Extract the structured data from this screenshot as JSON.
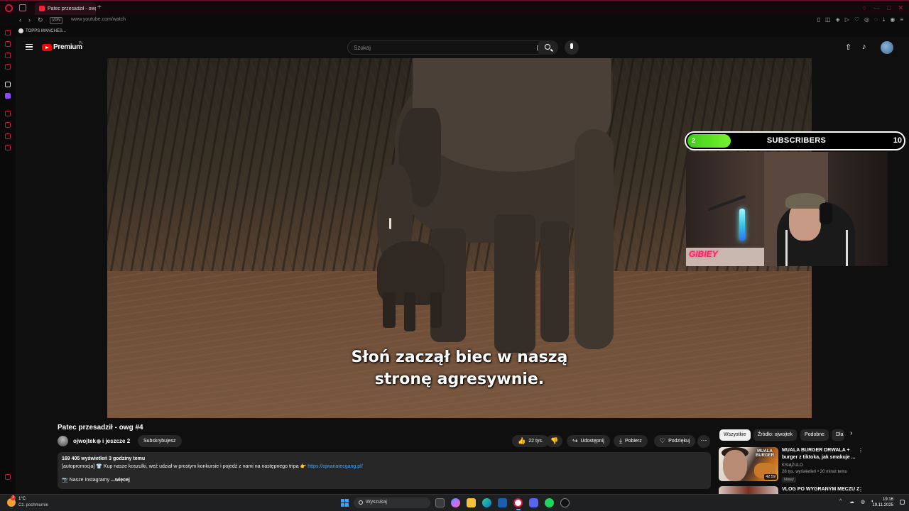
{
  "browser": {
    "tab_title": "Patec przesadził - owg",
    "url": "www.youtube.com/watch",
    "vpn_label": "VPN",
    "bookmark_label": "TOPPS MANCHES...",
    "accent_color": "#d4143d"
  },
  "youtube": {
    "brand": "Premium",
    "region": "PL",
    "search_placeholder": "Szukaj",
    "icons": [
      "menu-icon",
      "youtube-logo",
      "keyboard-icon",
      "search-icon",
      "mic-icon",
      "upload-icon",
      "bell-icon",
      "avatar"
    ]
  },
  "video": {
    "subtitle_line1": "Słoń zaczął biec w naszą",
    "subtitle_line2": "stronę agresywnie.",
    "overlay": {
      "current": "2",
      "label": "SUBSCRIBERS",
      "goal": "10",
      "progress_fraction": 0.2,
      "cam_tag": "GIBIEY"
    }
  },
  "watch": {
    "title": "Patec przesadził - owg #4",
    "channel_name": "ojwojtek",
    "channel_more": "i jeszcze 2",
    "subscribe_label": "Subskrybujesz",
    "like_count": "22 tys.",
    "share_label": "Udostępnij",
    "download_label": "Pobierz",
    "thanks_label": "Podziękuj",
    "more_label": "⋯",
    "description": {
      "stats": "169 405 wyświetleń  3 godziny temu",
      "promo_text": "[autopromocja] 👕 Kup nasze koszulki, weź udział w prostym konkursie i pojedź z nami na następnego tripa 👉",
      "promo_link": "https://ojwariatecgang.pl/",
      "instagram_text": "📷 Nasze Instagramy",
      "more_link": "...więcej"
    }
  },
  "sidebar": {
    "chips": [
      "Wszystkie",
      "Źródło: ojwojtek",
      "Podobne",
      "Dla"
    ],
    "recommendations": [
      {
        "title": "MUALA BURGER DRWALA + burger z tiktoka, jak smakuje ...",
        "channel": "KSIĄŻULO",
        "meta": "28 tys. wyświetleń • 20 minut temu",
        "badge": "Nowy",
        "duration": "42:59",
        "thumb_text": "MUALA BURGER"
      },
      {
        "title": "VLOG PO WYGRANYM MECZU Z"
      }
    ]
  },
  "taskbar": {
    "weather_temp": "1°C",
    "weather_desc": "Cz. pochmurnie",
    "weather_badge": "3",
    "search_placeholder": "Wyszukaj",
    "time": "19:16",
    "date": "19.11.2025"
  }
}
